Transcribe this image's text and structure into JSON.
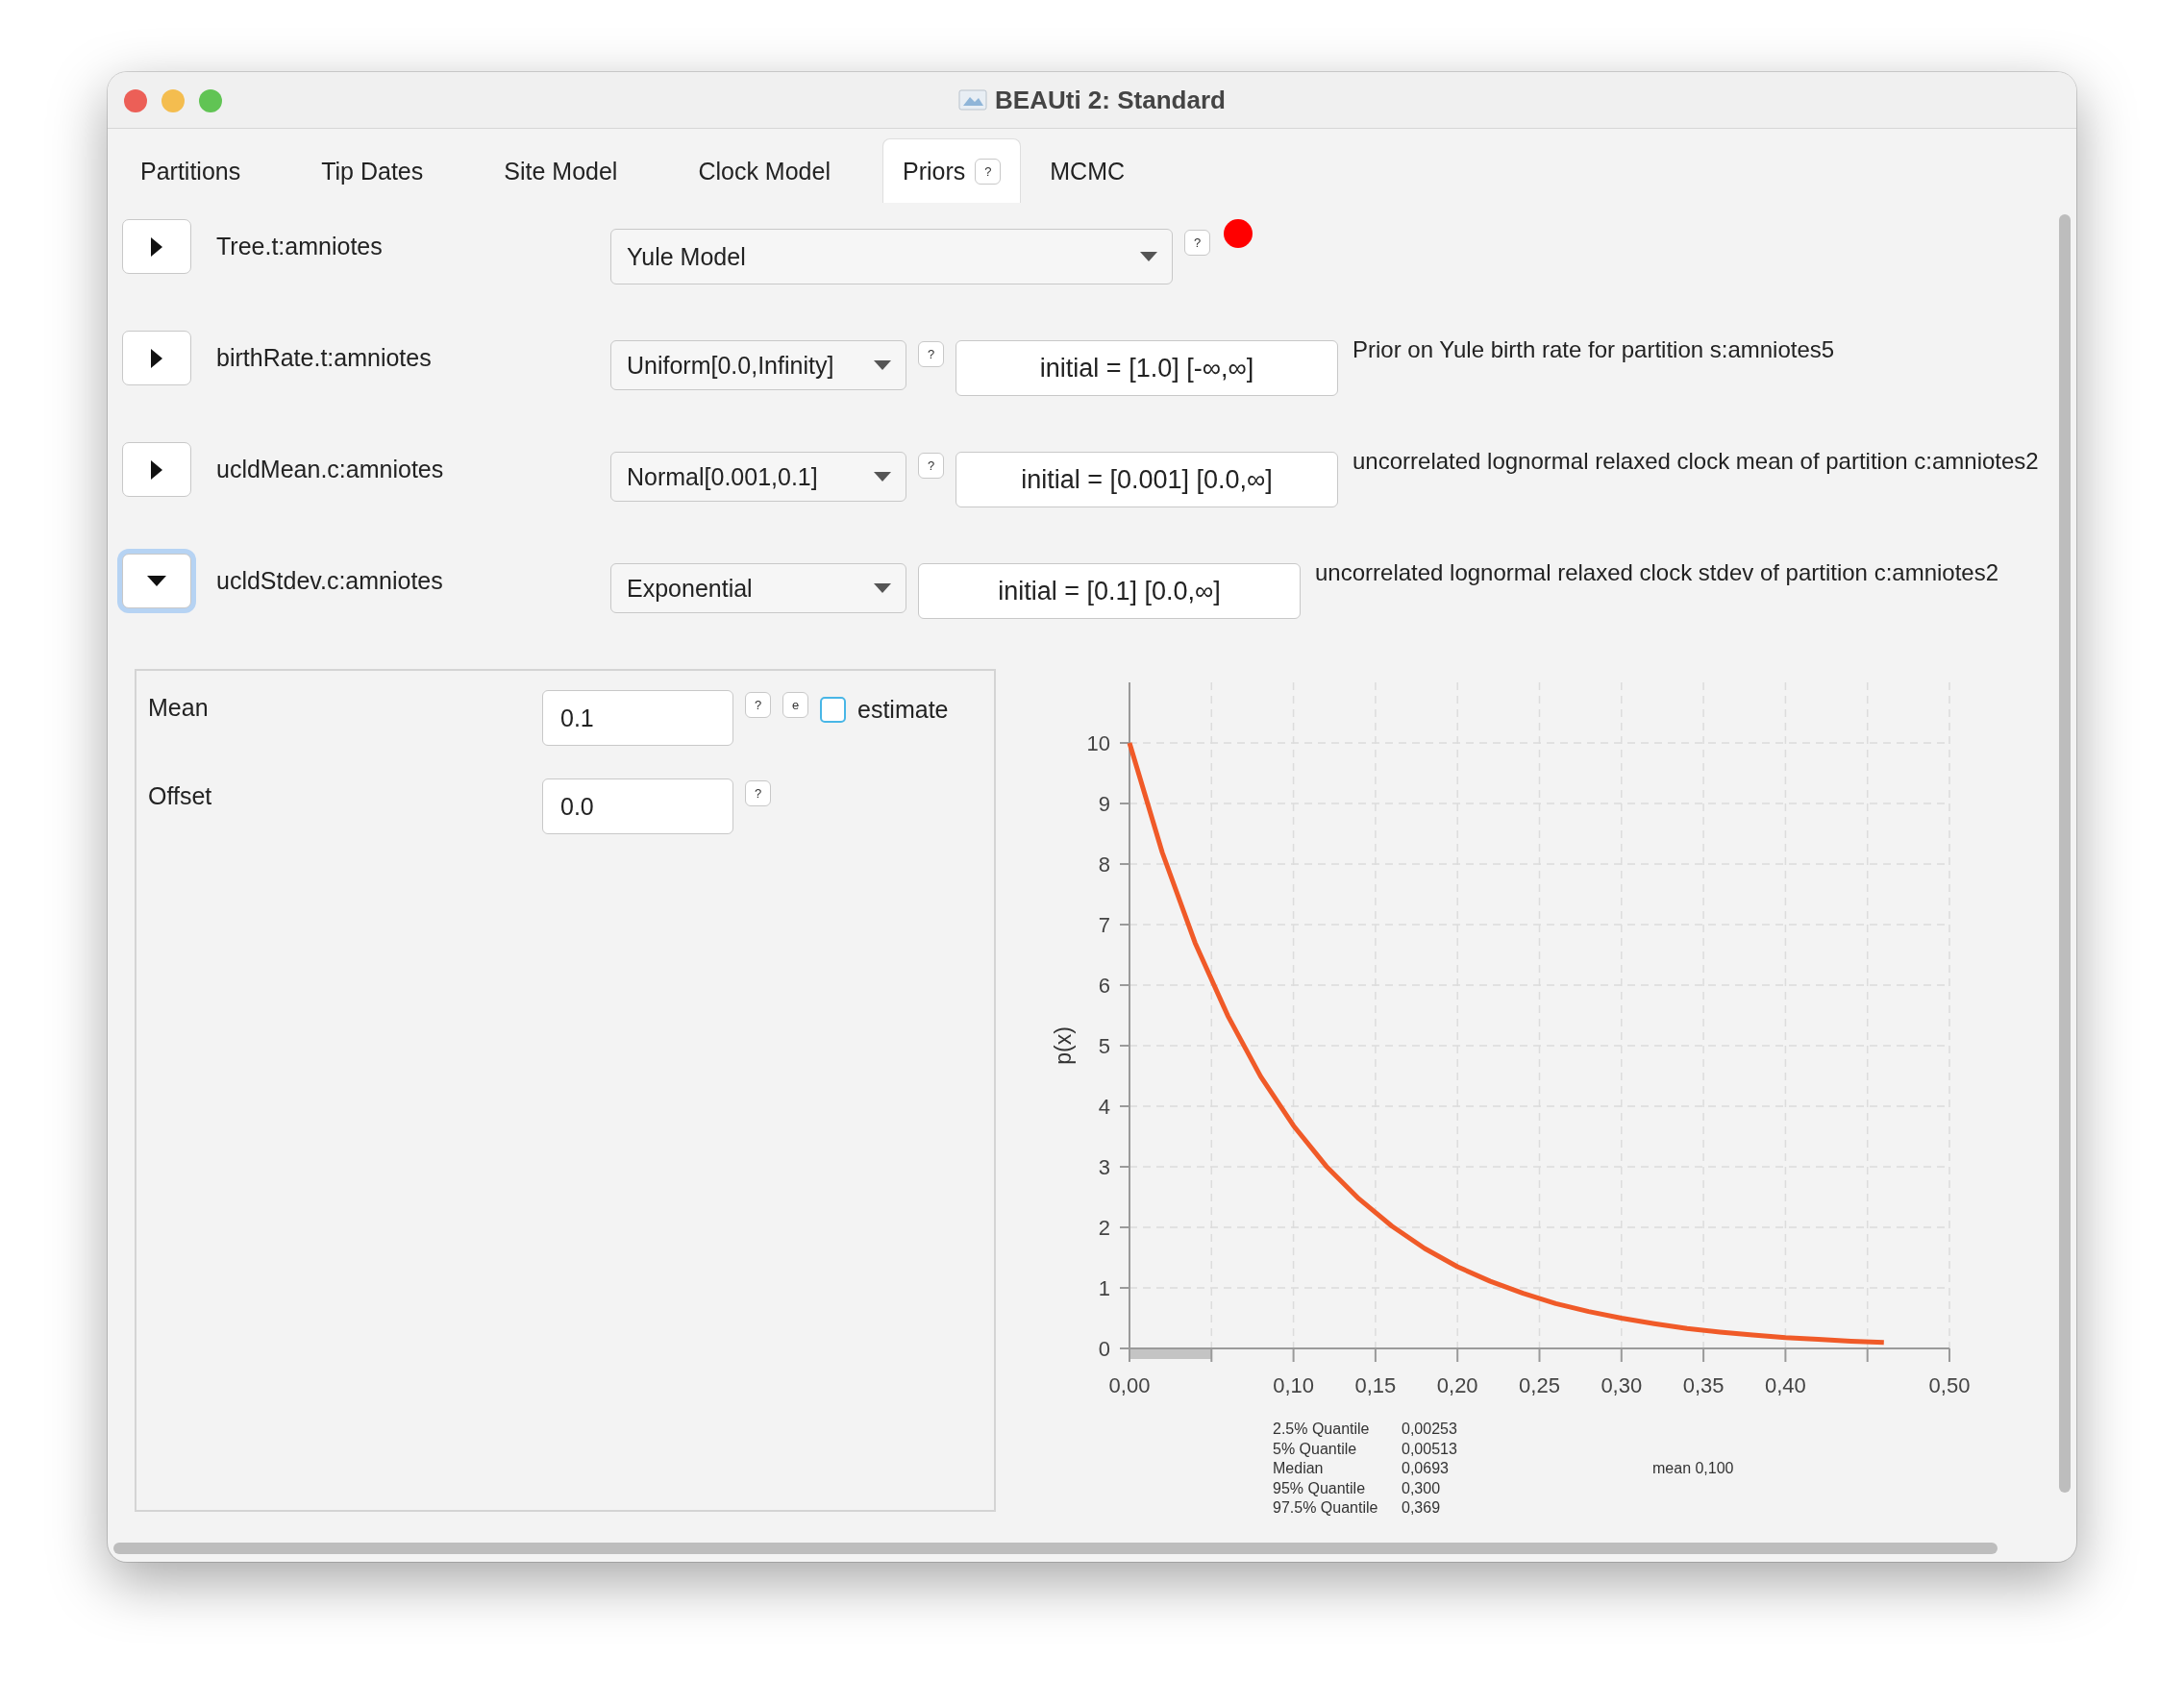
{
  "window": {
    "title": "BEAUti 2: Standard"
  },
  "tabs": [
    {
      "label": "Partitions",
      "selected": false
    },
    {
      "label": "Tip Dates",
      "selected": false
    },
    {
      "label": "Site Model",
      "selected": false
    },
    {
      "label": "Clock Model",
      "selected": false
    },
    {
      "label": "Priors",
      "selected": true,
      "help": "?"
    },
    {
      "label": "MCMC",
      "selected": false
    }
  ],
  "priors": [
    {
      "kind": "tree",
      "name": "Tree.t:amniotes",
      "expanded": false,
      "distribution": "Yule Model",
      "help": "?",
      "alert": true
    },
    {
      "kind": "parameter",
      "name": "birthRate.t:amniotes",
      "expanded": false,
      "distribution": "Uniform[0.0,Infinity]",
      "help": "?",
      "initial": "initial = [1.0] [-∞,∞]",
      "description": "Prior on Yule birth rate for partition s:amniotes5",
      "alert": false
    },
    {
      "kind": "parameter",
      "name": "ucldMean.c:amniotes",
      "expanded": false,
      "distribution": "Normal[0.001,0.1]",
      "help": "?",
      "initial": "initial = [0.001] [0.0,∞]",
      "description": "uncorrelated lognormal relaxed clock mean of partition c:amniotes2",
      "alert": false
    },
    {
      "kind": "parameter",
      "name": "ucldStdev.c:amniotes",
      "expanded": true,
      "distribution": "Exponential",
      "initial": "initial = [0.1] [0.0,∞]",
      "description": "uncorrelated lognormal relaxed clock stdev of partition c:amniotes2",
      "alert": false
    }
  ],
  "details": {
    "params": [
      {
        "label": "Mean",
        "value": "0.1",
        "help": "?",
        "extra_button": "e",
        "estimate": {
          "label": "estimate",
          "checked": false
        }
      },
      {
        "label": "Offset",
        "value": "0.0",
        "help": "?"
      }
    ],
    "chart_data": {
      "type": "line",
      "ylabel": "p(x)",
      "xlim": [
        0,
        0.5
      ],
      "ylim": [
        0,
        10
      ],
      "x": [
        0,
        0.02,
        0.04,
        0.06,
        0.08,
        0.1,
        0.12,
        0.14,
        0.16,
        0.18,
        0.2,
        0.22,
        0.24,
        0.26,
        0.28,
        0.3,
        0.32,
        0.34,
        0.36,
        0.38,
        0.4,
        0.42,
        0.44,
        0.46
      ],
      "series": [
        {
          "color": "#f05a28",
          "values": [
            10,
            8.19,
            6.7,
            5.49,
            4.49,
            3.68,
            3.01,
            2.47,
            2.02,
            1.65,
            1.35,
            1.11,
            0.91,
            0.74,
            0.61,
            0.5,
            0.41,
            0.33,
            0.27,
            0.22,
            0.18,
            0.15,
            0.12,
            0.1
          ]
        }
      ],
      "grid": true,
      "xticks": [
        {
          "value": 0,
          "label": "0,00"
        },
        {
          "value": 0.1,
          "label": "0,10"
        },
        {
          "value": 0.15,
          "label": "0,15"
        },
        {
          "value": 0.2,
          "label": "0,20"
        },
        {
          "value": 0.25,
          "label": "0,25"
        },
        {
          "value": 0.3,
          "label": "0,30"
        },
        {
          "value": 0.35,
          "label": "0,35"
        },
        {
          "value": 0.4,
          "label": "0,40"
        },
        {
          "value": 0.5,
          "label": "0,50"
        }
      ],
      "yticks": [
        0,
        1,
        2,
        3,
        4,
        5,
        6,
        7,
        8,
        9,
        10
      ]
    },
    "stats": [
      {
        "label": "2.5% Quantile",
        "value": "0,00253"
      },
      {
        "label": "5% Quantile",
        "value": "0,00513"
      },
      {
        "label": "Median",
        "value": "0,0693"
      },
      {
        "label": "95% Quantile",
        "value": "0,300"
      },
      {
        "label": "97.5% Quantile",
        "value": "0,369"
      }
    ],
    "mean": "mean 0,100"
  }
}
